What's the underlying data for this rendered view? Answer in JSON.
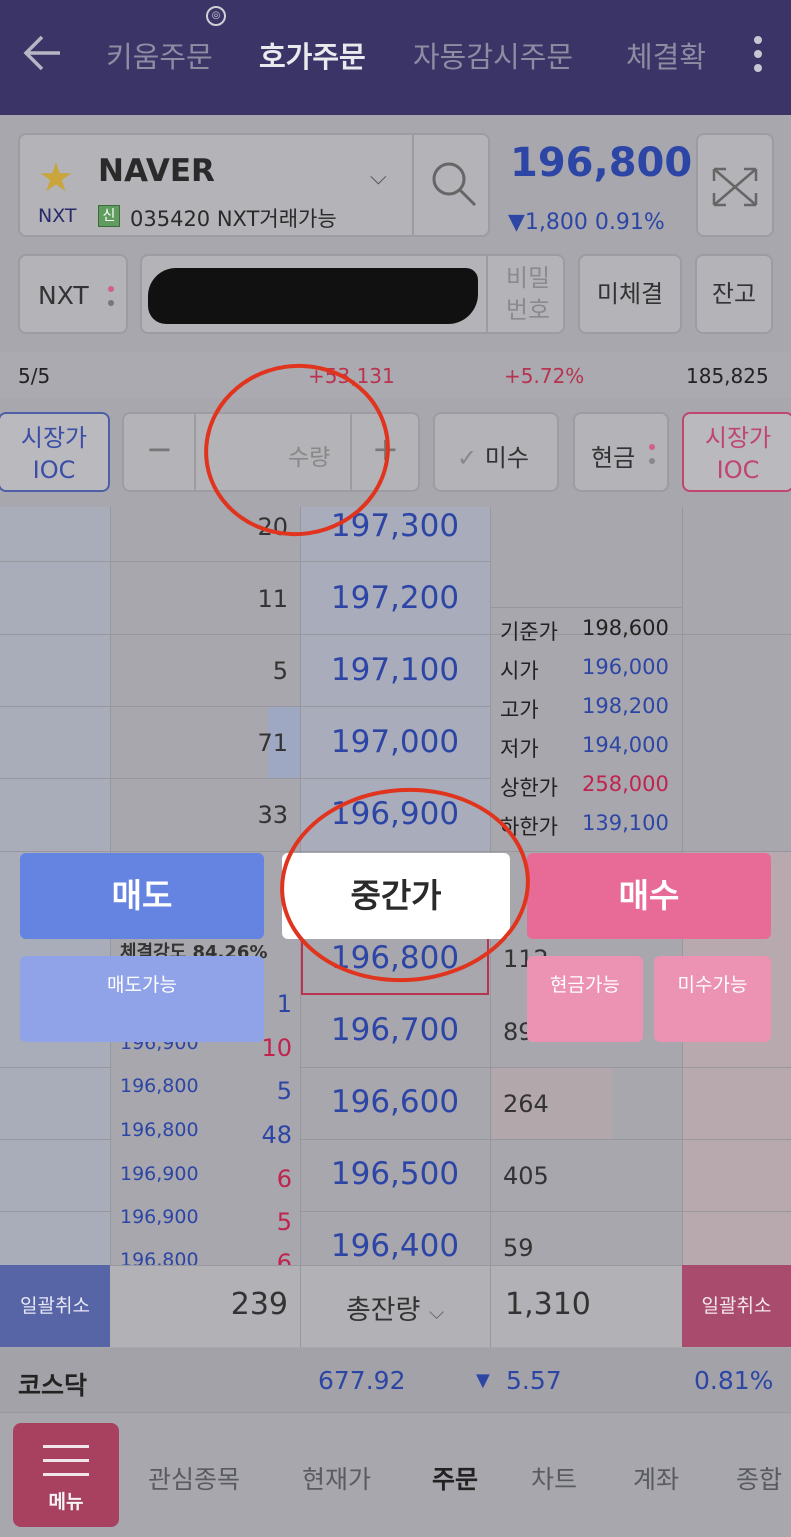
{
  "header": {
    "tabs": [
      "키움주문",
      "호가주문",
      "자동감시주문",
      "체결확"
    ],
    "active_tab": "호가주문"
  },
  "stock": {
    "name": "NAVER",
    "market": "NXT",
    "credit_badge": "신",
    "code_info": "035420  NXT거래가능",
    "price": "196,800",
    "change": "▼1,800  0.91%",
    "change_color": "#2d46a6"
  },
  "account": {
    "type": "NXT",
    "password_label": "비밀\n번호",
    "unfilled_button": "미체결",
    "balance_button": "잔고"
  },
  "stats": {
    "ratio": "5/5",
    "diff": "+53,131",
    "pct": "+5.72%",
    "volume": "185,825"
  },
  "order_controls": {
    "left_type": "시장가\nIOC",
    "qty_placeholder": "수량",
    "margin_label": "미수",
    "cash_label": "현금",
    "right_type": "시장가\nIOC"
  },
  "asks": [
    {
      "qty": "20",
      "price": "197,300"
    },
    {
      "qty": "11",
      "price": "197,200"
    },
    {
      "qty": "5",
      "price": "197,100"
    },
    {
      "qty": "71",
      "price": "197,000"
    },
    {
      "qty": "33",
      "price": "196,900"
    }
  ],
  "bids": [
    {
      "price": "196,800",
      "qty": "112"
    },
    {
      "price": "196,700",
      "qty": "89"
    },
    {
      "price": "196,600",
      "qty": "264"
    },
    {
      "price": "196,500",
      "qty": "405"
    },
    {
      "price": "196,400",
      "qty": "59"
    }
  ],
  "info": [
    {
      "label": "기준가",
      "value": "198,600",
      "color": "dark"
    },
    {
      "label": "시가",
      "value": "196,000",
      "color": "blue"
    },
    {
      "label": "고가",
      "value": "198,200",
      "color": "blue"
    },
    {
      "label": "저가",
      "value": "194,000",
      "color": "blue"
    },
    {
      "label": "상한가",
      "value": "258,000",
      "color": "red"
    },
    {
      "label": "하한가",
      "value": "139,100",
      "color": "blue"
    }
  ],
  "trade_strength": "체결강도 84.26%",
  "ticks": [
    {
      "price": "",
      "qty": "1",
      "color": "#2d46a6"
    },
    {
      "price": "196,900",
      "qty": "10",
      "color": "#c0234e"
    },
    {
      "price": "196,800",
      "qty": "5",
      "color": "#2d46a6"
    },
    {
      "price": "196,800",
      "qty": "48",
      "color": "#2d46a6"
    },
    {
      "price": "196,900",
      "qty": "6",
      "color": "#c0234e"
    },
    {
      "price": "196,900",
      "qty": "5",
      "color": "#c0234e"
    },
    {
      "price": "196,800",
      "qty": "6",
      "color": "#c0234e"
    }
  ],
  "actions": {
    "sell": "매도",
    "mid": "중간가",
    "buy": "매수",
    "sellable": "매도가능",
    "cash_buyable": "현금가능",
    "margin_buyable": "미수가능"
  },
  "totals": {
    "cancel_all_left": "일괄취소",
    "ask_total": "239",
    "label": "총잔량",
    "bid_total": "1,310",
    "cancel_all_right": "일괄취소"
  },
  "index": {
    "name": "코스닥",
    "value": "677.92",
    "change": "5.57",
    "pct": "0.81%"
  },
  "nav": {
    "menu": "메뉴",
    "items": [
      "관심종목",
      "현재가",
      "주문",
      "차트",
      "계좌",
      "종합"
    ],
    "active": "주문"
  }
}
